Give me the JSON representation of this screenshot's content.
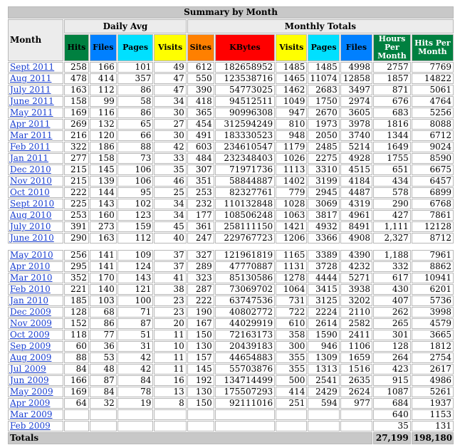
{
  "title": "Summary by Month",
  "headers": {
    "month": "Month",
    "daily_avg": "Daily Avg",
    "monthly_totals": "Monthly Totals",
    "columns": [
      {
        "label": "Hits",
        "bg": "#008040",
        "fg": "#000000"
      },
      {
        "label": "Files",
        "bg": "#0080ff",
        "fg": "#000000"
      },
      {
        "label": "Pages",
        "bg": "#00e0ff",
        "fg": "#000000"
      },
      {
        "label": "Visits",
        "bg": "#ffff00",
        "fg": "#000000"
      },
      {
        "label": "Sites",
        "bg": "#ff8000",
        "fg": "#000000"
      },
      {
        "label": "KBytes",
        "bg": "#ff0000",
        "fg": "#000000"
      },
      {
        "label": "Visits",
        "bg": "#ffff00",
        "fg": "#000000"
      },
      {
        "label": "Pages",
        "bg": "#00e0ff",
        "fg": "#000000"
      },
      {
        "label": "Files",
        "bg": "#0080ff",
        "fg": "#000000"
      },
      {
        "label": "Hours Per Month",
        "bg": "#008040",
        "fg": "#ffffff"
      },
      {
        "label": "Hits Per Month",
        "bg": "#008040",
        "fg": "#ffffff"
      }
    ]
  },
  "rows": [
    [
      "Sept 2011",
      "258",
      "166",
      "101",
      "49",
      "612",
      "182658952",
      "1485",
      "1485",
      "4998",
      "2757",
      "7769"
    ],
    [
      "Aug 2011",
      "478",
      "414",
      "357",
      "47",
      "550",
      "123538716",
      "1465",
      "11074",
      "12858",
      "1857",
      "14822"
    ],
    [
      "July 2011",
      "163",
      "112",
      "86",
      "47",
      "390",
      "54773025",
      "1462",
      "2683",
      "3497",
      "871",
      "5061"
    ],
    [
      "June 2011",
      "158",
      "99",
      "58",
      "34",
      "418",
      "94512511",
      "1049",
      "1750",
      "2974",
      "676",
      "4764"
    ],
    [
      "May 2011",
      "169",
      "116",
      "86",
      "30",
      "365",
      "90996308",
      "947",
      "2670",
      "3605",
      "683",
      "5256"
    ],
    [
      "Apr 2011",
      "269",
      "132",
      "65",
      "27",
      "454",
      "312594249",
      "810",
      "1973",
      "3978",
      "1816",
      "8088"
    ],
    [
      "Mar 2011",
      "216",
      "120",
      "66",
      "30",
      "491",
      "183330523",
      "948",
      "2050",
      "3740",
      "1344",
      "6712"
    ],
    [
      "Feb 2011",
      "322",
      "186",
      "88",
      "42",
      "603",
      "234610547",
      "1179",
      "2485",
      "5214",
      "1649",
      "9024"
    ],
    [
      "Jan 2011",
      "277",
      "158",
      "73",
      "33",
      "484",
      "232348403",
      "1026",
      "2275",
      "4928",
      "1755",
      "8590"
    ],
    [
      "Dec 2010",
      "215",
      "145",
      "106",
      "35",
      "307",
      "71971736",
      "1113",
      "3310",
      "4515",
      "651",
      "6675"
    ],
    [
      "Nov 2010",
      "215",
      "139",
      "106",
      "46",
      "351",
      "58844887",
      "1402",
      "3199",
      "4184",
      "434",
      "6457"
    ],
    [
      "Oct 2010",
      "222",
      "144",
      "95",
      "25",
      "253",
      "82327761",
      "779",
      "2945",
      "4487",
      "578",
      "6899"
    ],
    [
      "Sept 2010",
      "225",
      "143",
      "102",
      "34",
      "232",
      "110132848",
      "1028",
      "3069",
      "4319",
      "290",
      "6768"
    ],
    [
      "Aug 2010",
      "253",
      "160",
      "123",
      "34",
      "177",
      "108506248",
      "1063",
      "3817",
      "4961",
      "427",
      "7861"
    ],
    [
      "July 2010",
      "391",
      "273",
      "159",
      "45",
      "361",
      "258111150",
      "1421",
      "4932",
      "8491",
      "1,111",
      "12128"
    ],
    [
      "June 2010",
      "290",
      "163",
      "112",
      "40",
      "247",
      "229767723",
      "1206",
      "3366",
      "4908",
      "2,327",
      "8712"
    ],
    [
      "May 2010",
      "256",
      "141",
      "109",
      "37",
      "327",
      "121961819",
      "1165",
      "3389",
      "4390",
      "1,188",
      "7961"
    ],
    [
      "Apr 2010",
      "295",
      "141",
      "124",
      "37",
      "289",
      "47770887",
      "1131",
      "3728",
      "4232",
      "332",
      "8862"
    ],
    [
      "Mar 2010",
      "352",
      "170",
      "143",
      "41",
      "323",
      "85130586",
      "1278",
      "4444",
      "5271",
      "617",
      "10941"
    ],
    [
      "Feb 2010",
      "221",
      "140",
      "121",
      "38",
      "287",
      "73069702",
      "1064",
      "3415",
      "3938",
      "430",
      "6201"
    ],
    [
      "Jan 2010",
      "185",
      "103",
      "100",
      "23",
      "222",
      "63747536",
      "731",
      "3125",
      "3202",
      "407",
      "5736"
    ],
    [
      "Dec 2009",
      "128",
      "68",
      "71",
      "23",
      "190",
      "40802772",
      "722",
      "2224",
      "2110",
      "262",
      "3998"
    ],
    [
      "Nov 2009",
      "152",
      "86",
      "87",
      "20",
      "167",
      "44029919",
      "610",
      "2614",
      "2582",
      "265",
      "4579"
    ],
    [
      "Oct 2009",
      "118",
      "77",
      "51",
      "11",
      "150",
      "72163173",
      "358",
      "1590",
      "2411",
      "301",
      "3665"
    ],
    [
      "Sep 2009",
      "60",
      "36",
      "31",
      "10",
      "130",
      "20439183",
      "300",
      "946",
      "1106",
      "128",
      "1812"
    ],
    [
      "Aug 2009",
      "88",
      "53",
      "42",
      "11",
      "157",
      "44654883",
      "355",
      "1309",
      "1659",
      "264",
      "2754"
    ],
    [
      "Jul 2009",
      "84",
      "48",
      "42",
      "11",
      "145",
      "55703876",
      "355",
      "1313",
      "1516",
      "423",
      "2617"
    ],
    [
      "Jun 2009",
      "166",
      "87",
      "84",
      "16",
      "192",
      "134714499",
      "500",
      "2541",
      "2635",
      "915",
      "4986"
    ],
    [
      "May 2009",
      "169",
      "84",
      "78",
      "13",
      "130",
      "175507293",
      "414",
      "2429",
      "2624",
      "1087",
      "5261"
    ],
    [
      "Apr 2009",
      "64",
      "32",
      "19",
      "8",
      "150",
      "92111016",
      "251",
      "594",
      "977",
      "684",
      "1937"
    ],
    [
      "Mar 2009",
      "",
      "",
      "",
      "",
      "",
      "",
      "",
      "",
      "",
      "640",
      "1153"
    ],
    [
      "Feb 2009",
      "",
      "",
      "",
      "",
      "",
      "",
      "",
      "",
      "",
      "35",
      "131"
    ]
  ],
  "gap_after_index": 15,
  "totals": {
    "label": "Totals",
    "hours": "27,199",
    "hits": "198,180"
  }
}
